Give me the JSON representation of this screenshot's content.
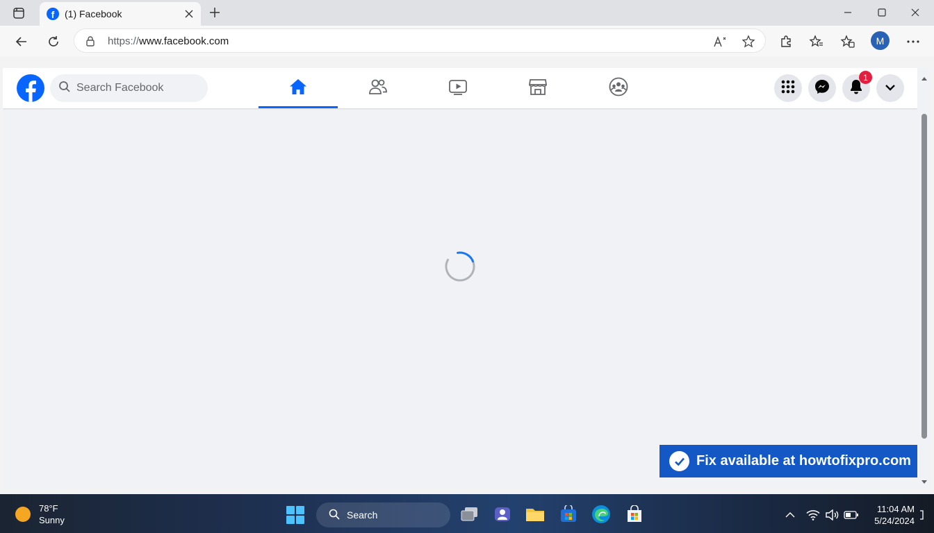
{
  "browser": {
    "tab": {
      "title": "(1) Facebook",
      "favicon": "facebook-f-icon"
    },
    "url": {
      "scheme": "https://",
      "host": "www.facebook.com"
    },
    "profile_initial": "M",
    "icons": [
      "back-icon",
      "refresh-icon",
      "lock-icon",
      "read-aloud-icon",
      "favorite-star-icon",
      "extensions-icon",
      "favorites-icon",
      "collections-icon",
      "more-icon"
    ]
  },
  "facebook": {
    "logo": "f",
    "search_placeholder": "Search Facebook",
    "nav_tabs": [
      "home",
      "friends",
      "video",
      "marketplace",
      "groups"
    ],
    "active_tab": "home",
    "notification_count": "1",
    "accent": "#0866ff",
    "status": "loading"
  },
  "banner": {
    "text": "Fix available at howtofixpro.com",
    "color": "#1358c4"
  },
  "taskbar": {
    "weather": {
      "temp": "78°F",
      "condition": "Sunny"
    },
    "search_label": "Search",
    "time": "11:04 AM",
    "date": "5/24/2024"
  }
}
